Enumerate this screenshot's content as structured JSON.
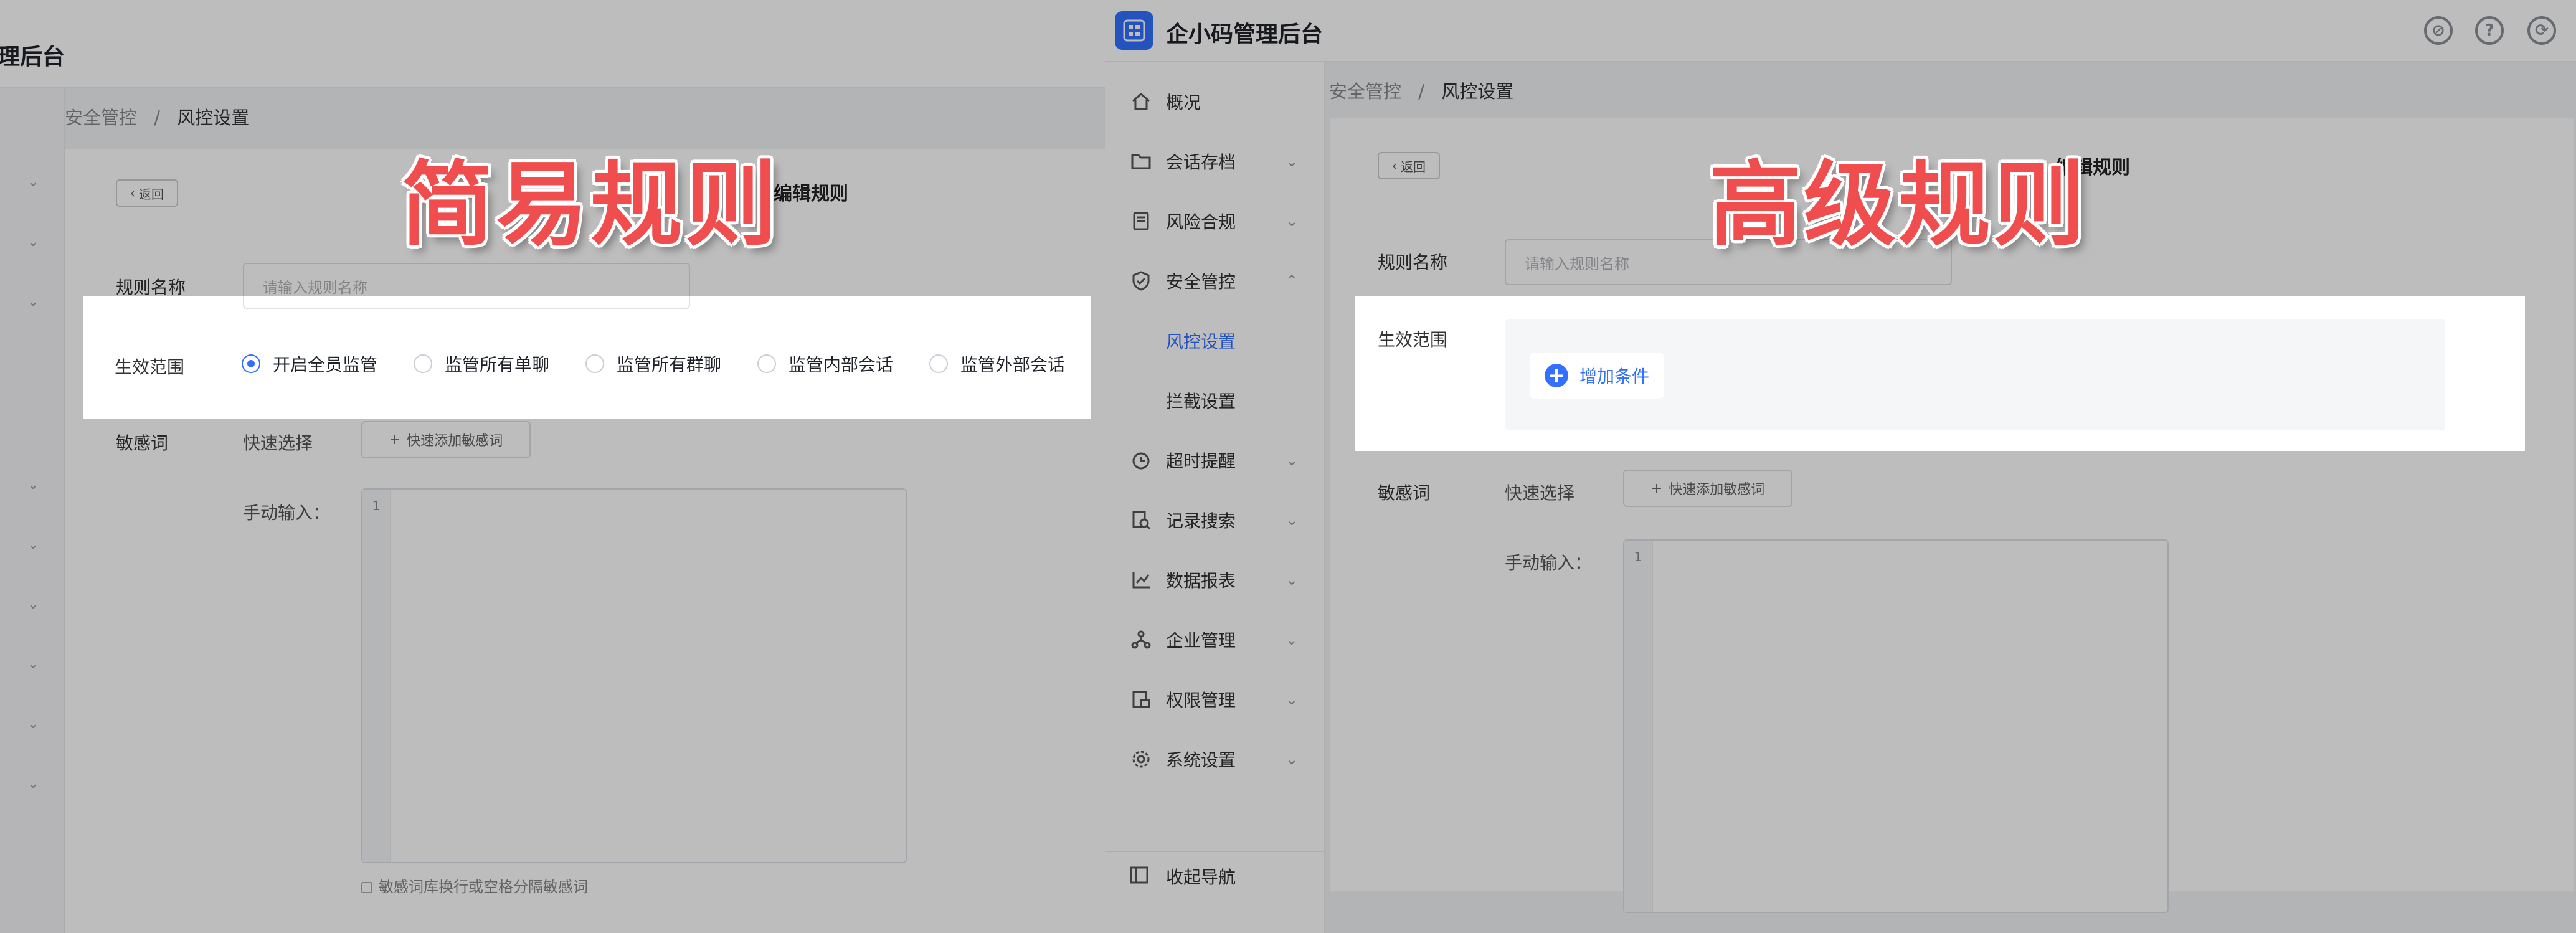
{
  "banners": {
    "simple": "简易规则",
    "advanced": "高级规则"
  },
  "left": {
    "app_title": "理后台",
    "breadcrumb": {
      "parent": "安全管控",
      "separator": "/",
      "current": "风控设置"
    },
    "back_label": "返回",
    "page_title": "编辑规则",
    "rule_name": {
      "label": "规则名称",
      "placeholder": "请输入规则名称"
    },
    "scope": {
      "label": "生效范围",
      "options": [
        "开启全员监管",
        "监管所有单聊",
        "监管所有群聊",
        "监管内部会话",
        "监管外部会话"
      ],
      "selected": "开启全员监管"
    },
    "sensitive": {
      "label": "敏感词",
      "quick_label": "快速选择",
      "quick_button": "快速添加敏感词",
      "manual_label": "手动输入："
    },
    "textarea_line": "1",
    "hint": "敏感词库换行或空格分隔敏感词"
  },
  "right": {
    "app_title": "企小码管理后台",
    "header_icons": [
      "compass-icon",
      "help-icon",
      "refresh-icon"
    ],
    "nav": [
      {
        "label": "概况",
        "icon": "home-icon",
        "chevron": false
      },
      {
        "label": "会话存档",
        "icon": "folder-icon",
        "chevron": true
      },
      {
        "label": "风险合规",
        "icon": "book-icon",
        "chevron": true
      },
      {
        "label": "安全管控",
        "icon": "shield-icon",
        "chevron": true
      },
      {
        "label": "风控设置",
        "icon": "",
        "chevron": false,
        "sub": true,
        "active": true
      },
      {
        "label": "拦截设置",
        "icon": "",
        "chevron": false,
        "sub": true
      },
      {
        "label": "超时提醒",
        "icon": "clock-icon",
        "chevron": true
      },
      {
        "label": "记录搜索",
        "icon": "search-doc-icon",
        "chevron": true
      },
      {
        "label": "数据报表",
        "icon": "chart-icon",
        "chevron": true
      },
      {
        "label": "企业管理",
        "icon": "org-icon",
        "chevron": true
      },
      {
        "label": "权限管理",
        "icon": "lock-icon",
        "chevron": true
      },
      {
        "label": "系统设置",
        "icon": "gear-icon",
        "chevron": true
      }
    ],
    "collapse_label": "收起导航",
    "breadcrumb": {
      "parent": "安全管控",
      "separator": "/",
      "current": "风控设置"
    },
    "back_label": "返回",
    "page_title": "编辑规则",
    "rule_name": {
      "label": "规则名称",
      "placeholder": "请输入规则名称"
    },
    "scope": {
      "label": "生效范围",
      "add_condition": "增加条件"
    },
    "sensitive": {
      "label": "敏感词",
      "quick_label": "快速选择",
      "quick_button": "快速添加敏感词",
      "manual_label": "手动输入："
    },
    "textarea_line": "1"
  },
  "colors": {
    "accent": "#3370ff",
    "banner": "#f04e4e"
  }
}
